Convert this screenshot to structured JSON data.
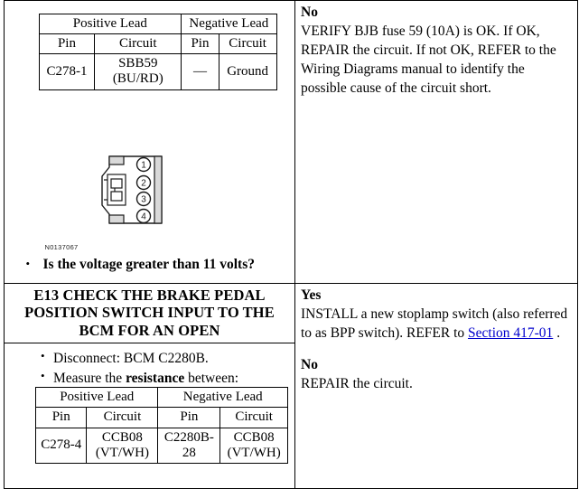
{
  "document": {
    "type": "automotive-service-diagnostic-page"
  },
  "row1": {
    "left": {
      "lead_table": {
        "group_headers": [
          "Positive Lead",
          "Negative Lead"
        ],
        "sub_headers": [
          "Pin",
          "Circuit",
          "Pin",
          "Circuit"
        ],
        "rows": [
          [
            "C278-1",
            "SBB59 (BU/RD)",
            "—",
            "Ground"
          ]
        ]
      },
      "figure": {
        "caption": "N0137067",
        "pin_labels": [
          "1",
          "2",
          "3",
          "4"
        ],
        "alt": "four-pin electrical connector end view"
      },
      "question": "Is the voltage greater than 11 volts?"
    },
    "right": {
      "answers": [
        {
          "label": "No",
          "text": "VERIFY BJB fuse 59 (10A) is OK. If OK, REPAIR the circuit. If not OK, REFER to the Wiring Diagrams manual to identify the possible cause of the circuit short."
        }
      ]
    }
  },
  "row2": {
    "left": {
      "step_heading": "E13 CHECK THE BRAKE PEDAL POSITION SWITCH INPUT TO THE BCM FOR AN OPEN",
      "bullets": [
        {
          "pre": "Disconnect: BCM C2280B.",
          "bold": "",
          "post": ""
        },
        {
          "pre": "Measure the ",
          "bold": "resistance",
          "post": " between:"
        }
      ],
      "lead_table": {
        "group_headers": [
          "Positive Lead",
          "Negative Lead"
        ],
        "sub_headers": [
          "Pin",
          "Circuit",
          "Pin",
          "Circuit"
        ],
        "rows": [
          [
            "C278-4",
            "CCB08 (VT/WH)",
            "C2280B-28",
            "CCB08 (VT/WH)"
          ]
        ]
      }
    },
    "right": {
      "answers": [
        {
          "label": "Yes",
          "text_before_link": "INSTALL a new stoplamp switch (also referred to as BPP switch). REFER to ",
          "link_text": "Section 417-01",
          "text_after_link": " ."
        },
        {
          "label": "No",
          "text": "REPAIR the circuit."
        }
      ]
    }
  },
  "colors": {
    "link": "#0000cc",
    "border": "#000000",
    "text": "#000000",
    "background": "#ffffff"
  }
}
